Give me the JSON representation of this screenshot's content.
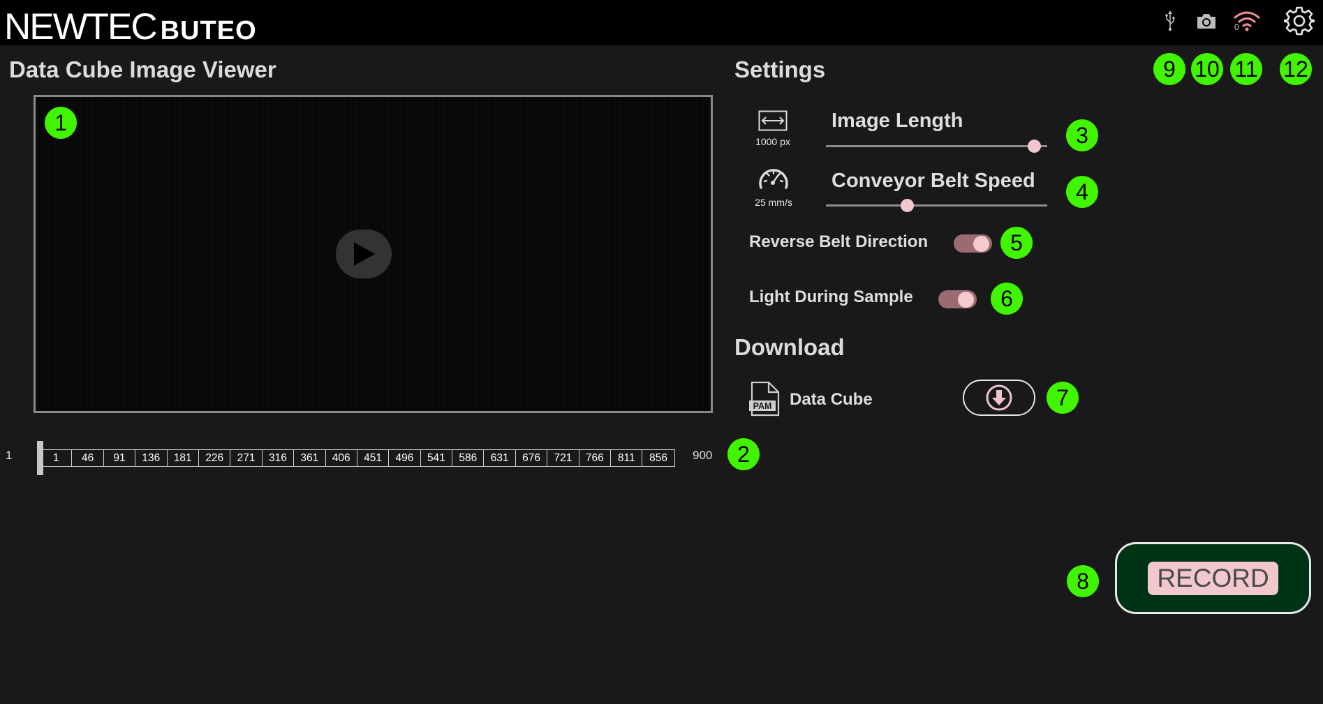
{
  "header": {
    "logo_main": "NEWTEC",
    "logo_sub": "BUTEO",
    "wifi_count": "0"
  },
  "viewer": {
    "title": "Data Cube Image Viewer",
    "timeline_start": "1",
    "timeline_end": "900",
    "ticks": [
      "1",
      "46",
      "91",
      "136",
      "181",
      "226",
      "271",
      "316",
      "361",
      "406",
      "451",
      "496",
      "541",
      "586",
      "631",
      "676",
      "721",
      "766",
      "811",
      "856"
    ]
  },
  "settings": {
    "title": "Settings",
    "image_length": {
      "label": "Image Length",
      "value_text": "1000 px",
      "slider_level": 0.97
    },
    "belt_speed": {
      "label": "Conveyor Belt Speed",
      "value_text": "25 mm/s",
      "slider_level": 0.36
    },
    "reverse_belt": {
      "label": "Reverse Belt Direction",
      "on": true
    },
    "light_sample": {
      "label": "Light During Sample",
      "on": true
    }
  },
  "download": {
    "title": "Download",
    "file_icon_text": "PAM",
    "item_label": "Data Cube"
  },
  "record_button": {
    "label": "RECORD"
  },
  "badges": [
    "1",
    "2",
    "3",
    "4",
    "5",
    "6",
    "7",
    "8",
    "9",
    "10",
    "11",
    "12"
  ],
  "colors": {
    "badge": "#41f400",
    "accent_pink": "#f4c7cf",
    "record_bg": "#003316",
    "toggle_track": "#9a6b73"
  }
}
